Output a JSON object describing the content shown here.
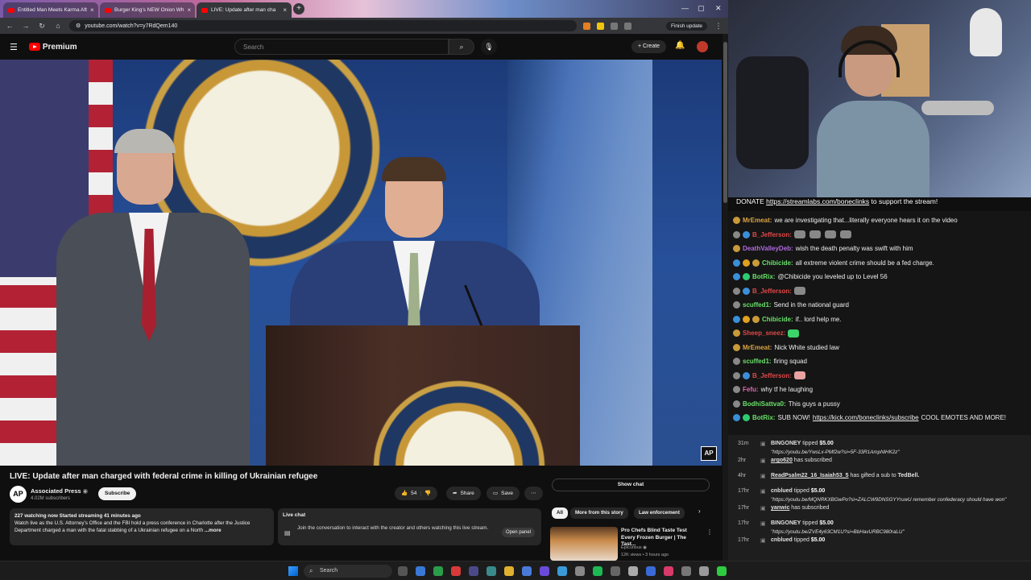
{
  "browser": {
    "tabs": [
      {
        "label": "Entitled Man Meets Karma Aft",
        "active": false
      },
      {
        "label": "Burger King's NEW Onion Wh",
        "active": false
      },
      {
        "label": "LIVE: Update after man cha",
        "active": true
      }
    ],
    "new_tab": "+",
    "window_controls": [
      "—",
      "▢",
      "✕"
    ],
    "url": "youtube.com/watch?v=y7RdQem140",
    "finish_update": "Finish update"
  },
  "youtube": {
    "logo_text": "Premium",
    "search_placeholder": "Search",
    "create_label": "Create",
    "video": {
      "title": "LIVE: Update after man charged with federal crime in killing of Ukrainian refugee",
      "watermark": "AP",
      "channel_avatar_text": "AP",
      "channel_name": "Associated Press",
      "subscribers": "4.02M subscribers",
      "subscribe_label": "Subscribe",
      "likes": "54",
      "share_label": "Share",
      "save_label": "Save",
      "more_label": "⋯"
    },
    "description": {
      "meta": "227 watching now  Started streaming 41 minutes ago",
      "text": "Watch live as the U.S. Attorney's Office and the FBI hold a press conference in Charlotte after the Justice Department charged a man with the fatal stabbing of a Ukrainian refugee on a North",
      "more": "...more"
    },
    "live_chat_card": {
      "title": "Live chat",
      "text": "Join the conversation to interact with the creator and others watching this live stream.",
      "open_panel": "Open panel"
    },
    "show_chat": "Show chat",
    "chips": [
      "All",
      "More from this story",
      "Law enforcement"
    ],
    "recommendation": {
      "title": "Pro Chefs Blind Taste Test Every Frozen Burger | The Tast...",
      "channel": "Epicurious",
      "meta": "12K views • 3 hours ago"
    }
  },
  "stream": {
    "donate_prefix": "DONATE ",
    "donate_link": "https://streamlabs.com/boneclinks",
    "donate_suffix": " to support the stream!"
  },
  "chat": [
    {
      "user": "MrEmeat:",
      "color": "#d9a441",
      "text": "we are investigating that...literally everyone hears it on the video",
      "badges": [
        "#c99a3a"
      ]
    },
    {
      "user": "B_Jefferson:",
      "color": "#e04848",
      "text": "",
      "emotes": 4,
      "badges": [
        "#888",
        "#3a8fd9"
      ]
    },
    {
      "user": "DeathValleyDeb:",
      "color": "#b06ae0",
      "text": "wish the death penalty was swift with him",
      "badges": [
        "#c99a3a"
      ]
    },
    {
      "user": "Chibicide:",
      "color": "#6ae06a",
      "text": "all extreme violent crime should be a fed charge.",
      "badges": [
        "#3a8fd9",
        "#e0a020",
        "#c99a3a"
      ]
    },
    {
      "user": "BotRix:",
      "color": "#6ae06a",
      "text": "@Chibicide you leveled up to Level 56",
      "badges": [
        "#3a8fd9",
        "#2ecc71"
      ]
    },
    {
      "user": "B_Jefferson:",
      "color": "#e04848",
      "text": "",
      "emotes": 1,
      "badges": [
        "#888",
        "#3a8fd9"
      ]
    },
    {
      "user": "scuffed1:",
      "color": "#6ae06a",
      "text": "Send in the national guard",
      "badges": [
        "#888"
      ]
    },
    {
      "user": "Chibicide:",
      "color": "#6ae06a",
      "text": "if.. lord help me.",
      "badges": [
        "#3a8fd9",
        "#e0a020",
        "#c99a3a"
      ]
    },
    {
      "user": "Sheep_sneez:",
      "color": "#e04848",
      "text": "",
      "emotes": 1,
      "emote_color": "green",
      "badges": [
        "#c99a3a"
      ]
    },
    {
      "user": "MrEmeat:",
      "color": "#d9a441",
      "text": "Nick White studied law",
      "badges": [
        "#c99a3a"
      ]
    },
    {
      "user": "scuffed1:",
      "color": "#6ae06a",
      "text": "firing squad",
      "badges": [
        "#888"
      ]
    },
    {
      "user": "B_Jefferson:",
      "color": "#e04848",
      "text": "",
      "emotes": 1,
      "emote_color": "pink",
      "badges": [
        "#888",
        "#3a8fd9"
      ]
    },
    {
      "user": "Fefu:",
      "color": "#e06ab0",
      "text": "why tf he laughing",
      "badges": [
        "#888"
      ]
    },
    {
      "user": "BodhiSattva0:",
      "color": "#6ae06a",
      "text": "This guys a pussy",
      "badges": [
        "#888"
      ]
    },
    {
      "user": "BotRix:",
      "color": "#6ae06a",
      "text": "SUB NOW! ",
      "link": "https://kick.com/boneclinks/subscribe",
      "after": " COOL EMOTES AND MORE!",
      "badges": [
        "#3a8fd9",
        "#2ecc71"
      ]
    }
  ],
  "events": [
    {
      "time": "31m",
      "name": "BINGONEY",
      "action": " tipped ",
      "amount": "$5.00",
      "sub": "\"https://youtu.be/YwsLx-PMf2w?si=5F-33R1AmpNlHK2z\""
    },
    {
      "time": "2hr",
      "name": "argo620",
      "action": " has subscribed"
    },
    {
      "time": "4hr",
      "name": "ReadPsalm22_16_Isaiah53_5",
      "action": " has gifted a sub to ",
      "target": "TedBell."
    },
    {
      "time": "17hr",
      "name": "cnblued",
      "action": " tipped ",
      "amount": "$5.00",
      "sub": "\"https://youtu.be/MQNRKXBGwPo?si=ZALCW9DNSGYYruwU remember confederacy should have won\""
    },
    {
      "time": "17hr",
      "name": "yanwic",
      "action": " has subscribed"
    },
    {
      "time": "17hr",
      "name": "BINGONEY",
      "action": " tipped ",
      "amount": "$5.00",
      "sub": "\"https://youtu.be/ZVE4y63CM1U?si=BbHavURBC980raLU\""
    },
    {
      "time": "17hr",
      "name": "cnblued",
      "action": " tipped ",
      "amount": "$5.00"
    }
  ],
  "taskbar": {
    "search_placeholder": "Search"
  }
}
